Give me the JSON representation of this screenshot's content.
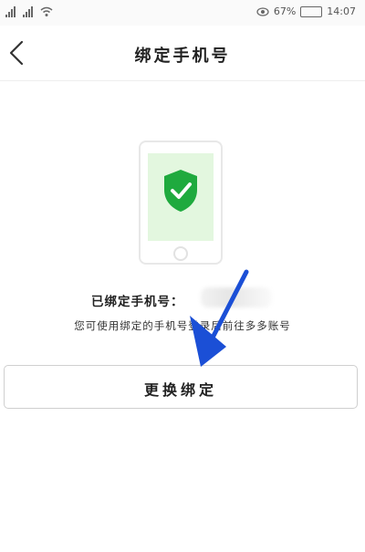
{
  "status_bar": {
    "battery": "67%",
    "time": "14:07"
  },
  "header": {
    "title": "绑定手机号"
  },
  "content": {
    "bound_label": "已绑定手机号：",
    "hint": "您可使用绑定的手机号登录后前往多多账号"
  },
  "actions": {
    "change_binding": "更换绑定"
  },
  "colors": {
    "shield": "#1faa3e",
    "screen_bg": "#e3f7df",
    "arrow": "#1b4fd6"
  }
}
